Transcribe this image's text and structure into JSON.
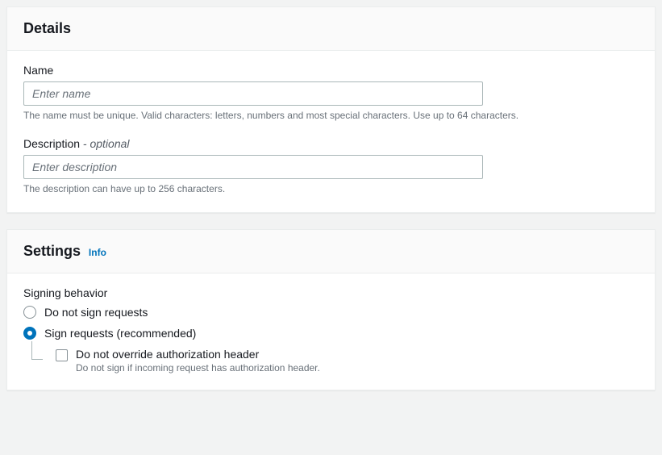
{
  "details": {
    "title": "Details",
    "name": {
      "label": "Name",
      "placeholder": "Enter name",
      "value": "",
      "help": "The name must be unique. Valid characters: letters, numbers and most special characters. Use up to 64 characters."
    },
    "description": {
      "label": "Description",
      "optional_suffix": " - optional",
      "placeholder": "Enter description",
      "value": "",
      "help": "The description can have up to 256 characters."
    }
  },
  "settings": {
    "title": "Settings",
    "info_link": "Info",
    "signing_behavior": {
      "label": "Signing behavior",
      "options": {
        "do_not_sign": "Do not sign requests",
        "sign": "Sign requests (recommended)"
      },
      "selected": "sign",
      "override_checkbox": {
        "label": "Do not override authorization header",
        "help": "Do not sign if incoming request has authorization header.",
        "checked": false
      }
    }
  }
}
